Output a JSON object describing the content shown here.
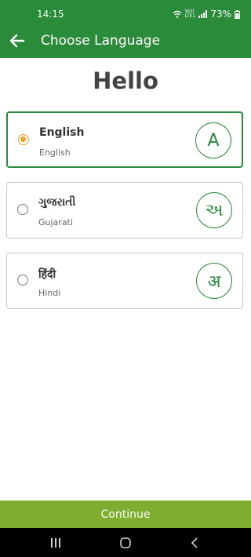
{
  "status_bar": {
    "time": "14:15",
    "volte_top": "Vo))",
    "volte_bottom": "LTE1",
    "battery": "73%"
  },
  "header": {
    "title": "Choose Language",
    "back_icon": "arrow-left-icon"
  },
  "greeting": "Hello",
  "languages": [
    {
      "native": "English",
      "name": "English",
      "letter": "A",
      "selected": true
    },
    {
      "native": "ગુજરાતી",
      "name": "Gujarati",
      "letter": "અ",
      "selected": false
    },
    {
      "native": "हिंदी",
      "name": "Hindi",
      "letter": "अ",
      "selected": false
    }
  ],
  "continue_label": "Continue",
  "colors": {
    "primary": "#2a8b3a",
    "accent_radio": "#f2a21d",
    "continue_bg": "#7fad2f"
  }
}
